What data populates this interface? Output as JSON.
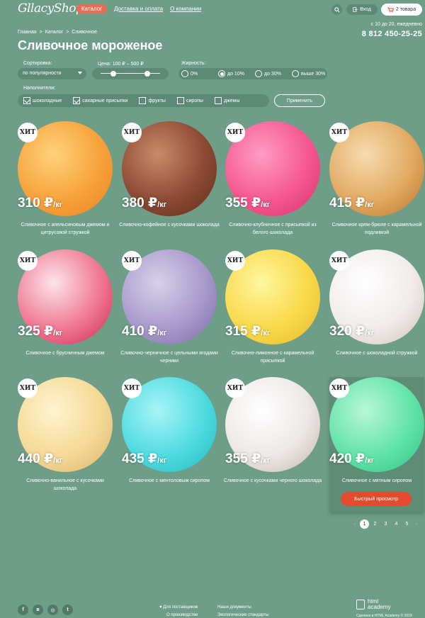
{
  "header": {
    "logo": "GllacyShop",
    "nav": [
      "Каталог",
      "Доставка и оплата",
      "О компании"
    ],
    "login": "Вход",
    "cart": "2 товара",
    "hours": "с 10 до 20, ежедневно",
    "phone": "8 812 450-25-25"
  },
  "breadcrumbs": [
    "Главная",
    ">",
    "Каталог",
    ">",
    "Сливочное"
  ],
  "title": "Сливочное мороженое",
  "filters": {
    "sort_label": "Сортировка:",
    "sort_value": "по популярности",
    "price_label": "Цена: 100 ₽ – 500 ₽",
    "price_min_fraction": 0.22,
    "price_max_fraction": 0.78,
    "fat_label": "Жирность:",
    "fat_options": [
      {
        "label": "0%",
        "checked": false
      },
      {
        "label": "до 10%",
        "checked": true
      },
      {
        "label": "до 30%",
        "checked": false
      },
      {
        "label": "выше 30%",
        "checked": false
      }
    ],
    "fillers_label": "Наполнители:",
    "fillers": [
      {
        "label": "шоколадные",
        "checked": true
      },
      {
        "label": "сахарные присыпки",
        "checked": true
      },
      {
        "label": "фрукты",
        "checked": false
      },
      {
        "label": "сиропы",
        "checked": false
      },
      {
        "label": "джемы",
        "checked": false
      }
    ],
    "apply": "Применить"
  },
  "products": [
    {
      "badge": "ХИТ",
      "price": "310 ₽",
      "unit": "/кг",
      "name": "Сливочное с апельсиновым джемом и цитрусовой стружкой",
      "colors": [
        "#ffd27a",
        "#f7a23b",
        "#e98322"
      ]
    },
    {
      "badge": "ХИТ",
      "price": "380 ₽",
      "unit": "/кг",
      "name": "Сливочно-кофейное с кусочками шоколада",
      "colors": [
        "#c98a6a",
        "#8c4a33",
        "#5e2d1f"
      ]
    },
    {
      "badge": "ХИТ",
      "price": "355 ₽",
      "unit": "/кг",
      "name": "Сливочно-клубничное с присыпкой из белого шоколада",
      "colors": [
        "#ff9cc4",
        "#f5588f",
        "#d8306b"
      ]
    },
    {
      "badge": "ХИТ",
      "price": "415 ₽",
      "unit": "/кг",
      "name": "Сливочное крем-брюле с карамельной подливкой",
      "colors": [
        "#f6dcb0",
        "#e2aa62",
        "#b9752d"
      ]
    },
    {
      "badge": "ХИТ",
      "price": "325 ₽",
      "unit": "/кг",
      "name": "Сливочное с брусничным джемом",
      "colors": [
        "#fce4ea",
        "#f07893",
        "#c92a4c"
      ]
    },
    {
      "badge": "ХИТ",
      "price": "410 ₽",
      "unit": "/кг",
      "name": "Сливочно-черничное с цельными ягодами черники",
      "colors": [
        "#d8d0ea",
        "#a89acb",
        "#7a6aa6"
      ]
    },
    {
      "badge": "ХИТ",
      "price": "315 ₽",
      "unit": "/кг",
      "name": "Сливочно-лимонное с карамельной присыпкой",
      "colors": [
        "#fff6a0",
        "#f9d94a",
        "#e4b82a"
      ]
    },
    {
      "badge": "ХИТ",
      "price": "320 ₽",
      "unit": "/кг",
      "name": "Сливочное с шоколадной стружкой",
      "colors": [
        "#ffffff",
        "#f1ecea",
        "#cdbfb9"
      ]
    },
    {
      "badge": "ХИТ",
      "price": "440 ₽",
      "unit": "/кг",
      "name": "Сливочно-ванильное с кусочками шоколада",
      "colors": [
        "#fff4cf",
        "#f5d996",
        "#d9b46a"
      ]
    },
    {
      "badge": "ХИТ",
      "price": "435 ₽",
      "unit": "/кг",
      "name": "Сливочное с ментоловым сиропом",
      "colors": [
        "#a8f4f6",
        "#4fdbe0",
        "#22b8c0"
      ]
    },
    {
      "badge": "ХИТ",
      "price": "355 ₽",
      "unit": "/кг",
      "name": "Сливочное с кусочками черного шоколада",
      "colors": [
        "#ffffff",
        "#ede8e5",
        "#bfb3ad"
      ]
    },
    {
      "badge": "ХИТ",
      "price": "420 ₽",
      "unit": "/кг",
      "name": "Сливочное с мятным сиропом",
      "colors": [
        "#b8f7d6",
        "#62e3a8",
        "#2fc384"
      ],
      "quick_view": "Быстрый просмотр"
    }
  ],
  "pagination": {
    "prev": "‹",
    "pages": [
      "1",
      "2",
      "3",
      "4",
      "5"
    ],
    "next": "›",
    "current": "1"
  },
  "footer": {
    "social": [
      "f",
      "в",
      "◎",
      "t"
    ],
    "col1": [
      "Для поставщиков",
      "О производстве"
    ],
    "col2": [
      "Наши документы",
      "Экологические стандарты"
    ],
    "academy": [
      "html",
      "academy"
    ],
    "copyright": "Сделано в HTML Academy © 2019"
  }
}
